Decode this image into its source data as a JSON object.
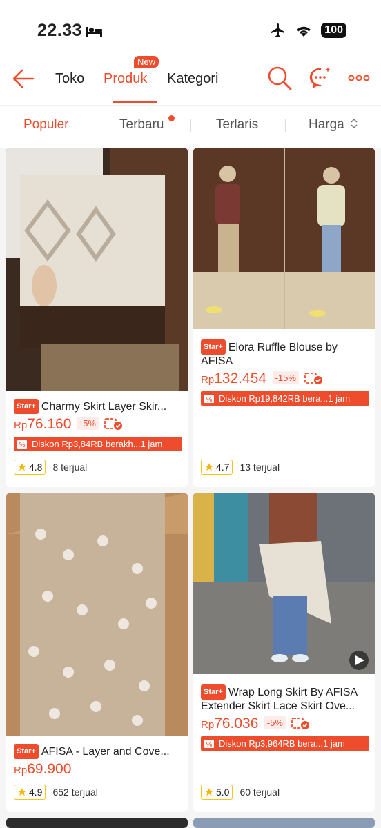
{
  "status": {
    "time": "22.33",
    "battery": "100"
  },
  "nav": {
    "tabs": [
      "Toko",
      "Produk",
      "Kategori"
    ],
    "active": "Produk",
    "new_badge": "New"
  },
  "sort": {
    "tabs": [
      "Populer",
      "Terbaru",
      "Terlaris",
      "Harga"
    ],
    "active": "Populer"
  },
  "colors": {
    "accent": "#ee4d2d"
  },
  "products": [
    {
      "badge": "Star+",
      "title": "Charmy Skirt Layer Skir...",
      "price_prefix": "Rp",
      "price": "76.160",
      "discount": "-5%",
      "coupon": "Diskon Rp3,84RB berakh...1 jam",
      "rating": "4.8",
      "sold": "8 terjual"
    },
    {
      "badge": "Star+",
      "title": "Elora Ruffle Blouse by AFISA",
      "price_prefix": "Rp",
      "price": "132.454",
      "discount": "-15%",
      "coupon": "Diskon Rp19,842RB bera...1 jam",
      "rating": "4.7",
      "sold": "13 terjual"
    },
    {
      "badge": "Star+",
      "title": "AFISA - Layer and Cove...",
      "price_prefix": "Rp",
      "price": "69.900",
      "discount": "",
      "coupon": "",
      "rating": "4.9",
      "sold": "652 terjual"
    },
    {
      "badge": "Star+",
      "title": "Wrap Long Skirt By AFISA Extender Skirt Lace Skirt Ove...",
      "price_prefix": "Rp",
      "price": "76.036",
      "discount": "-5%",
      "coupon": "Diskon Rp3,964RB bera...1 jam",
      "rating": "5.0",
      "sold": "60 terjual"
    }
  ]
}
